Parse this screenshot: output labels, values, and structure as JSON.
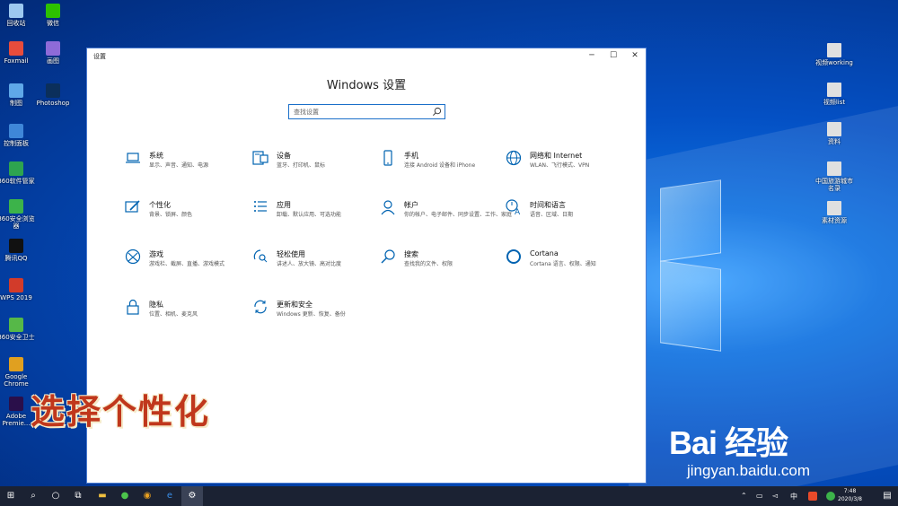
{
  "desktop": {
    "left_icons": [
      {
        "label": "回收站",
        "color": "#9cc8f0"
      },
      {
        "label": "微信",
        "color": "#2dc100"
      },
      {
        "label": "Foxmail",
        "color": "#e74c3c"
      },
      {
        "label": "画图",
        "color": "#8e6bd8"
      },
      {
        "label": "制图",
        "color": "#5fa8e8"
      },
      {
        "label": "Photoshop",
        "color": "#0b2f5b"
      },
      {
        "label": "控制面板",
        "color": "#3f87d8"
      },
      {
        "label": "360软件管家",
        "color": "#2ea44f"
      },
      {
        "label": "360安全浏览器",
        "color": "#3cb34a"
      },
      {
        "label": "腾讯QQ",
        "color": "#111111"
      },
      {
        "label": "WPS 2019",
        "color": "#d23b2a"
      },
      {
        "label": "360安全卫士",
        "color": "#56b848"
      },
      {
        "label": "Google Chrome",
        "color": "#e0a020"
      },
      {
        "label": "Adobe Premie...",
        "color": "#2a0f4a"
      }
    ],
    "right_icons": [
      {
        "label": "视频working",
        "color": "#e0e0e0"
      },
      {
        "label": "视频list",
        "color": "#e0e0e0"
      },
      {
        "label": "资料",
        "color": "#e0e0e0"
      },
      {
        "label": "中国旅游城市名录",
        "color": "#e0e0e0"
      },
      {
        "label": "素材资源",
        "color": "#e0e0e0"
      }
    ]
  },
  "window": {
    "title": "设置",
    "heading": "Windows 设置",
    "search_placeholder": "查找设置",
    "categories": [
      {
        "name": "系统",
        "desc": "显示、声音、通知、电源",
        "icon": "laptop-icon"
      },
      {
        "name": "设备",
        "desc": "蓝牙、打印机、鼠标",
        "icon": "keyboard-icon"
      },
      {
        "name": "手机",
        "desc": "连接 Android 设备和 iPhone",
        "icon": "phone-icon"
      },
      {
        "name": "网络和 Internet",
        "desc": "WLAN、飞行模式、VPN",
        "icon": "globe-icon"
      },
      {
        "name": "个性化",
        "desc": "背景、锁屏、颜色",
        "icon": "brush-icon"
      },
      {
        "name": "应用",
        "desc": "卸载、默认应用、可选功能",
        "icon": "list-icon"
      },
      {
        "name": "帐户",
        "desc": "你的帐户、电子邮件、同步设置、工作、家庭",
        "icon": "person-icon"
      },
      {
        "name": "时间和语言",
        "desc": "语音、区域、日期",
        "icon": "time-language-icon"
      },
      {
        "name": "游戏",
        "desc": "游戏栏、截屏、直播、游戏模式",
        "icon": "xbox-icon"
      },
      {
        "name": "轻松使用",
        "desc": "讲述人、放大镜、高对比度",
        "icon": "ease-of-access-icon"
      },
      {
        "name": "搜索",
        "desc": "查找我的文件、权限",
        "icon": "search-icon"
      },
      {
        "name": "Cortana",
        "desc": "Cortana 语言、权限、通知",
        "icon": "cortana-icon"
      },
      {
        "name": "隐私",
        "desc": "位置、相机、麦克风",
        "icon": "lock-icon"
      },
      {
        "name": "更新和安全",
        "desc": "Windows 更新、恢复、备份",
        "icon": "update-icon"
      }
    ]
  },
  "caption": "选择个性化",
  "watermark": {
    "brand": "Bai 经验",
    "url": "jingyan.baidu.com"
  },
  "taskbar": {
    "time": "7:48",
    "date": "2020/3/8"
  },
  "colors": {
    "accent": "#0063b1",
    "caption": "#c0371c",
    "taskbar": "#1b2233"
  }
}
